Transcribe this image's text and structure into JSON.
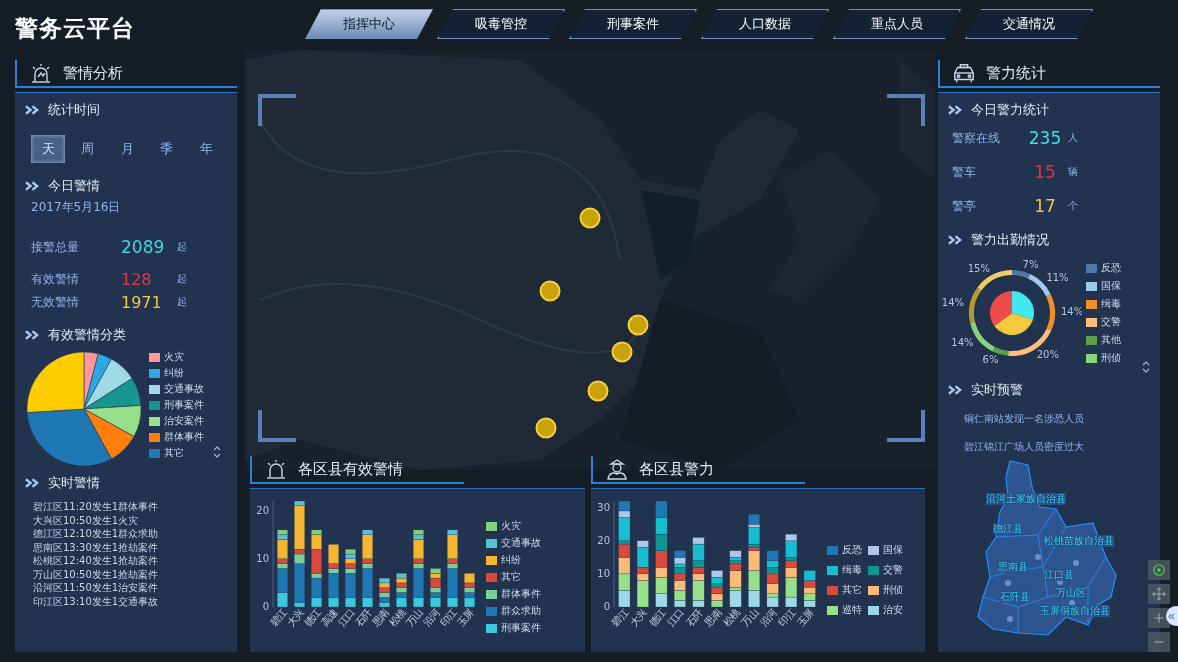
{
  "header": {
    "title": "警务云平台"
  },
  "nav_tabs": [
    {
      "label": "指挥中心",
      "selected": true
    },
    {
      "label": "吸毒管控",
      "selected": false
    },
    {
      "label": "刑事案件",
      "selected": false
    },
    {
      "label": "人口数据",
      "selected": false
    },
    {
      "label": "重点人员",
      "selected": false
    },
    {
      "label": "交通情况",
      "selected": false
    }
  ],
  "alert_analysis": {
    "title": "警情分析",
    "stat_time": {
      "heading": "统计时间",
      "periods": [
        {
          "label": "天",
          "selected": true
        },
        {
          "label": "周",
          "selected": false
        },
        {
          "label": "月",
          "selected": false
        },
        {
          "label": "季",
          "selected": false
        },
        {
          "label": "年",
          "selected": false
        }
      ]
    },
    "today": {
      "heading": "今日警情",
      "date": "2017年5月16日",
      "stats": [
        {
          "label": "接警总量",
          "value": "2089",
          "unit": "起",
          "color": "#3fd6e0"
        },
        {
          "label": "有效警情",
          "value": "128",
          "unit": "起",
          "color": "#e2363f"
        },
        {
          "label": "无效警情",
          "value": "1971",
          "unit": "起",
          "color": "#f0c93a"
        }
      ]
    },
    "categories": {
      "heading": "有效警情分类",
      "legend": [
        {
          "name": "火灾",
          "color": "#ff9896"
        },
        {
          "name": "纠纷",
          "color": "#2ea8e0"
        },
        {
          "name": "交通事故",
          "color": "#9edae5"
        },
        {
          "name": "刑事案件",
          "color": "#17958f"
        },
        {
          "name": "治安案件",
          "color": "#98df8a"
        },
        {
          "name": "群体事件",
          "color": "#ff7f0e"
        },
        {
          "name": "其它",
          "color": "#1f77b4"
        }
      ]
    },
    "realtime": {
      "heading": "实时警情",
      "items": [
        "碧江区11:20发生1群体事件",
        "大兴区10:50发生1火灾",
        "德江区12:10发生1群众求助",
        "思南区13:30发生1抢劫案件",
        "松桃区12:40发生1抢劫案件",
        "万山区10:50发生1抢劫案件",
        "沿河区11:50发生1治安案件",
        "印江区13:10发生1交通事故"
      ]
    }
  },
  "district_alerts": {
    "title": "各区县有效警情",
    "chart_data": {
      "type": "bar",
      "stacked": true,
      "categories": [
        "碧江",
        "大兴",
        "德江",
        "高速",
        "江口",
        "石阡",
        "思南",
        "松桃",
        "万山",
        "沿河",
        "印江",
        "玉屏"
      ],
      "yticks": [
        0,
        10,
        20
      ],
      "ylim": [
        0,
        22
      ],
      "series": [
        {
          "name": "火灾",
          "color": "#82d07f",
          "values": [
            1,
            0,
            1,
            0,
            1,
            0,
            0,
            0,
            1,
            1,
            0,
            0
          ]
        },
        {
          "name": "交通事故",
          "color": "#5bc0d4",
          "values": [
            1,
            1,
            0,
            0,
            1,
            1,
            1,
            1,
            1,
            0,
            1,
            0
          ]
        },
        {
          "name": "纠纷",
          "color": "#f5b731",
          "values": [
            4,
            9,
            3,
            4,
            1,
            5,
            1,
            1,
            4,
            1,
            5,
            2
          ]
        },
        {
          "name": "其它",
          "color": "#d9493c",
          "values": [
            1,
            1,
            5,
            1,
            1,
            1,
            1,
            1,
            1,
            2,
            1,
            1
          ]
        },
        {
          "name": "群体事件",
          "color": "#7dcf9a",
          "values": [
            1,
            2,
            1,
            1,
            1,
            1,
            1,
            1,
            1,
            1,
            1,
            1
          ]
        },
        {
          "name": "群众求助",
          "color": "#1f77b4",
          "values": [
            5,
            8,
            4,
            5,
            5,
            6,
            1,
            1,
            6,
            1,
            6,
            1
          ]
        },
        {
          "name": "刑事案件",
          "color": "#3cc8dc",
          "values": [
            3,
            1,
            2,
            2,
            2,
            2,
            1,
            2,
            2,
            2,
            2,
            2
          ]
        }
      ]
    }
  },
  "district_police": {
    "title": "各区县警力",
    "chart_data": {
      "type": "bar",
      "stacked": true,
      "categories": [
        "碧江",
        "大兴",
        "德江",
        "江口",
        "石阡",
        "思南",
        "松桃",
        "万山",
        "沿河",
        "印江",
        "玉屏"
      ],
      "yticks": [
        0,
        10,
        20,
        30
      ],
      "ylim": [
        0,
        32
      ],
      "series": [
        {
          "name": "反恐",
          "color": "#1f77b4",
          "values": [
            3,
            0,
            5,
            2,
            0,
            0,
            0,
            3,
            3,
            0,
            0
          ]
        },
        {
          "name": "国保",
          "color": "#aec7e8",
          "values": [
            2,
            2,
            0,
            2,
            2,
            2,
            2,
            1,
            0,
            2,
            0
          ]
        },
        {
          "name": "缉毒",
          "color": "#17becf",
          "values": [
            7,
            6,
            5,
            1,
            5,
            2,
            1,
            5,
            2,
            5,
            3
          ]
        },
        {
          "name": "交警",
          "color": "#0e9594",
          "values": [
            1,
            0,
            5,
            2,
            2,
            1,
            1,
            1,
            2,
            1,
            0
          ]
        },
        {
          "name": "其它",
          "color": "#d9493c",
          "values": [
            4,
            2,
            5,
            2,
            2,
            2,
            2,
            1,
            3,
            2,
            2
          ]
        },
        {
          "name": "刑侦",
          "color": "#ffbb78",
          "values": [
            5,
            2,
            3,
            3,
            2,
            2,
            5,
            6,
            3,
            3,
            2
          ]
        },
        {
          "name": "巡特",
          "color": "#98df8a",
          "values": [
            5,
            8,
            5,
            3,
            6,
            2,
            1,
            6,
            1,
            6,
            2
          ]
        },
        {
          "name": "治安",
          "color": "#9edae5",
          "values": [
            5,
            0,
            4,
            2,
            2,
            0,
            5,
            5,
            3,
            3,
            2
          ]
        }
      ]
    }
  },
  "police_stats": {
    "title": "警力统计",
    "today": {
      "heading": "今日警力统计",
      "stats": [
        {
          "label": "警察在线",
          "value": "235",
          "unit": "人",
          "color": "#3fe0e8"
        },
        {
          "label": "警车",
          "value": "15",
          "unit": "辆",
          "color": "#e2363f"
        },
        {
          "label": "警亭",
          "value": "17",
          "unit": "个",
          "color": "#f0c93a"
        }
      ]
    },
    "attendance": {
      "heading": "警力出勤情况",
      "legend": [
        {
          "name": "反恐",
          "color": "#4e79a7"
        },
        {
          "name": "国保",
          "color": "#a0cbe8"
        },
        {
          "name": "缉毒",
          "color": "#f28e2b"
        },
        {
          "name": "交警",
          "color": "#ffbe7d"
        },
        {
          "name": "其他",
          "color": "#59a14f"
        },
        {
          "name": "刑侦",
          "color": "#8cd17d"
        }
      ],
      "chart_data": {
        "type": "donut",
        "values": [
          7,
          11,
          14,
          20,
          6,
          14,
          14,
          15
        ],
        "data_labels": true,
        "value_labels": [
          "7%",
          "11%",
          "14%",
          "20%",
          "6%",
          "14%",
          "14%",
          "15%"
        ]
      }
    },
    "warnings": {
      "heading": "实时预警",
      "items": [
        "铜仁南站发现一名涉恐人员",
        "碧江锦江广场人员密度过大"
      ],
      "map_labels": [
        "沿河土家族自治县",
        "德江县",
        "松桃苗族自治县",
        "思南县",
        "江口县",
        "石阡县",
        "万山区",
        "玉屏侗族自治县"
      ]
    }
  },
  "map_controls": {
    "toggle": "«"
  }
}
